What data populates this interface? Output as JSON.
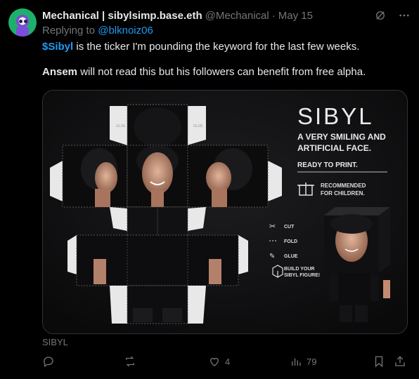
{
  "post": {
    "author_name": "Mechanical | sibylsimp.base.eth",
    "handle": "@Mechanical",
    "separator": "·",
    "date": "May 15",
    "reply_prefix": "Replying to",
    "reply_to": "@blknoiz06",
    "line1_tag": "$Sibyl",
    "line1_rest": " is the ticker I'm pounding the keyword for the last few weeks.",
    "line2_name": "Ansem",
    "line2_rest": " will not read this but his followers can benefit from free alpha.",
    "media_caption": "SIBYL"
  },
  "poster": {
    "title": "SIBYL",
    "subtitle_line1": "A VERY SMILING AND",
    "subtitle_line2": "ARTIFICIAL FACE.",
    "ready": "READY TO PRINT.",
    "rec_line1": "RECOMMENDED",
    "rec_line2": "FOR CHILDREN.",
    "legend": [
      {
        "icon": "scissors-icon",
        "label": "CUT"
      },
      {
        "icon": "fold-line-icon",
        "label": "FOLD"
      },
      {
        "icon": "glue-icon",
        "label": "GLUE"
      },
      {
        "icon": "cube-icon",
        "label": "BUILD YOUR",
        "label2": "SIBYL FIGURE!"
      }
    ],
    "glue_tab": "GLUE"
  },
  "actions": {
    "replies": "",
    "reposts": "",
    "likes": "4",
    "views": "79"
  },
  "colors": {
    "background": "#000000",
    "text": "#e7e9ea",
    "muted": "#71767b",
    "link": "#1d9bf0",
    "border": "#2f3336"
  }
}
